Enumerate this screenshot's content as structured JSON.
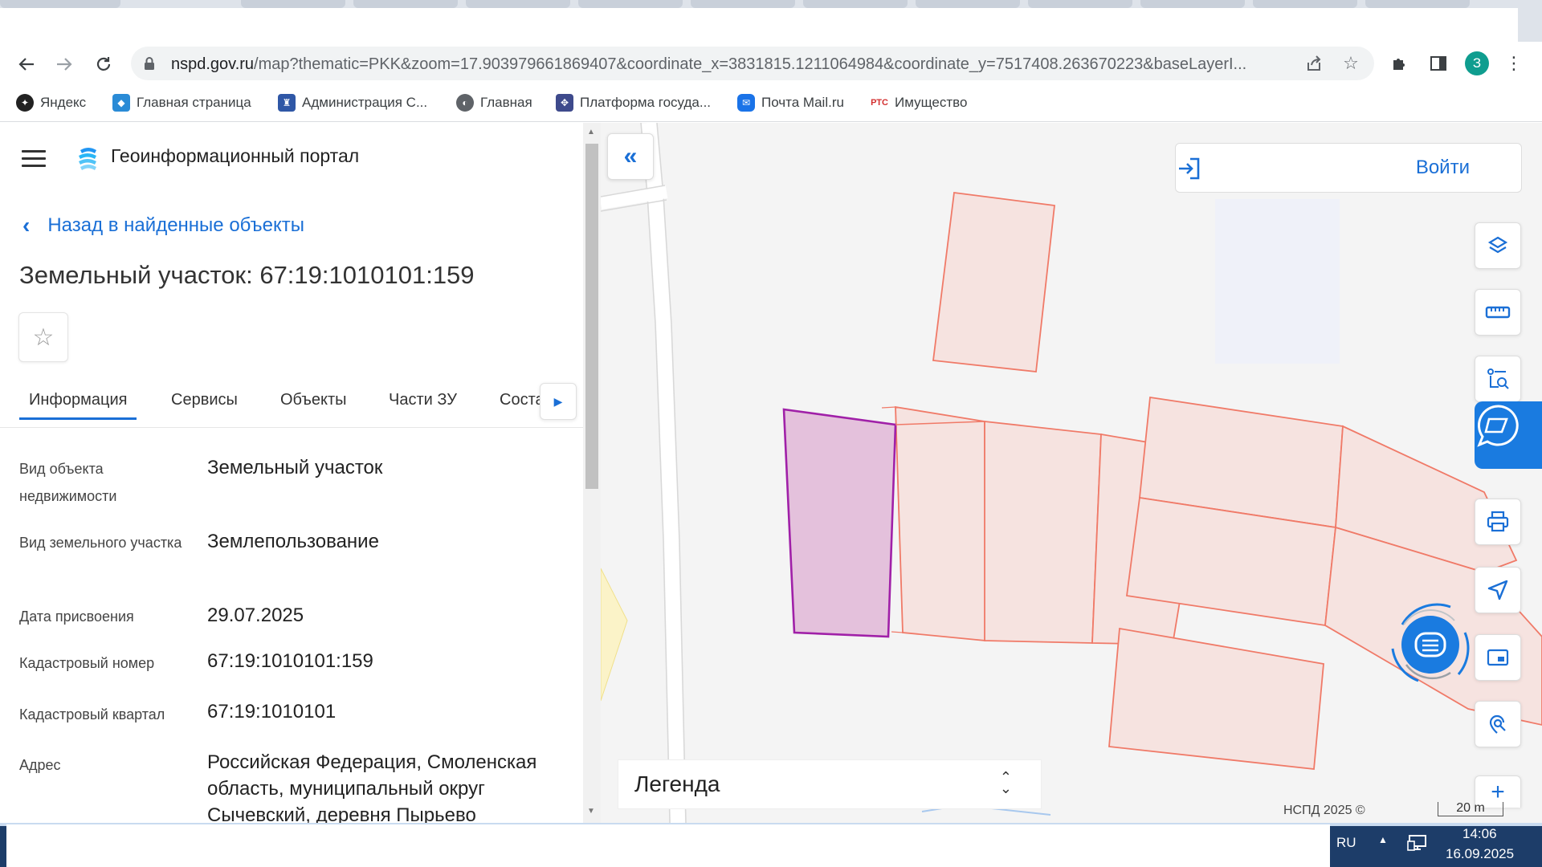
{
  "browser": {
    "url_host": "nspd.gov.ru",
    "url_rest": "/map?thematic=PKK&zoom=17.903979661869407&coordinate_x=3831815.1211064984&coordinate_y=7517408.263670223&baseLayerI...",
    "profile_initial": "З",
    "bookmarks": [
      {
        "label": "Яндекс",
        "icon": "yandex-icon",
        "color": "#222222"
      },
      {
        "label": "Главная страница",
        "icon": "emblem-icon",
        "color": "#2a8bd6"
      },
      {
        "label": "Администрация С...",
        "icon": "coat-of-arms-icon",
        "color": "#2f57a6"
      },
      {
        "label": "Главная",
        "icon": "globe-icon",
        "color": "#5f6368"
      },
      {
        "label": "Платформа госуда...",
        "icon": "eagle-icon",
        "color": "#3e4a8c"
      },
      {
        "label": "Почта Mail.ru",
        "icon": "mail-icon",
        "color": "#1a73e8"
      },
      {
        "label": "Имущество",
        "icon": "rts-icon",
        "color": "#d32f2f"
      }
    ]
  },
  "panel": {
    "portal_title": "Геоинформационный портал",
    "back_label": "Назад в найденные объекты",
    "title": "Земельный участок: 67:19:1010101:159",
    "tabs": [
      {
        "label": "Информация",
        "active": true
      },
      {
        "label": "Сервисы"
      },
      {
        "label": "Объекты"
      },
      {
        "label": "Части ЗУ"
      },
      {
        "label": "Соста"
      }
    ],
    "fields": [
      {
        "label": "Вид объекта недвижимости",
        "value": "Земельный участок"
      },
      {
        "label": "Вид земельного участка",
        "value": "Землепользование"
      },
      {
        "label": "Дата присвоения",
        "value": "29.07.2025"
      },
      {
        "label": "Кадастровый номер",
        "value": "67:19:1010101:159"
      },
      {
        "label": "Кадастровый квартал",
        "value": "67:19:1010101"
      },
      {
        "label": "Адрес",
        "value": "Российская Федерация, Смоленская область, муниципальный округ Сычевский, деревня Пырьево"
      }
    ]
  },
  "map": {
    "login_label": "Войти",
    "legend_label": "Легенда",
    "attribution": "НСПД 2025 ©",
    "scale_label": "20 m",
    "colors": {
      "selected_fill": "#e4c1dc",
      "selected_stroke": "#a020a8",
      "parcel_fill": "#f6e3e0",
      "parcel_stroke": "#f07a68",
      "accent": "#1a6fd6"
    }
  },
  "taskbar": {
    "lang": "RU",
    "time": "14:06",
    "date": "16.09.2025"
  }
}
